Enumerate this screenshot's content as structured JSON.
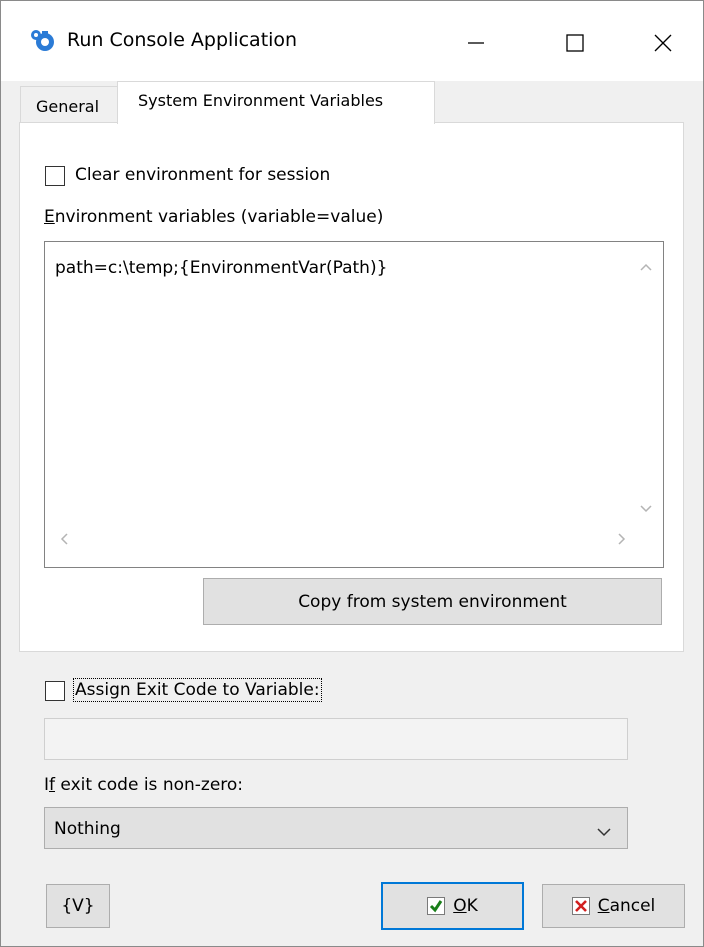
{
  "window": {
    "title": "Run Console Application"
  },
  "tabs": [
    {
      "label": "General"
    },
    {
      "label": "System Environment Variables"
    }
  ],
  "env_panel": {
    "clear_env_label": "Clear environment for session",
    "clear_env_checked": false,
    "env_vars_label": "Environment variables (variable=value)",
    "env_vars_value": "path=c:\\temp;{EnvironmentVar(Path)}",
    "copy_button_label": "Copy from system environment"
  },
  "exit_code": {
    "assign_label": "Assign Exit Code to Variable:",
    "assign_checked": false,
    "variable_value": "",
    "nonzero_label": "If exit code is non-zero:",
    "nonzero_selected": "Nothing"
  },
  "buttons": {
    "variables_label": "{V}",
    "ok_label": "OK",
    "cancel_label": "Cancel"
  },
  "colors": {
    "ok_check": "#1a7f1a",
    "cancel_x": "#d11f1f",
    "app_icon": "#2b7bd6",
    "focus_border": "#0078d7"
  }
}
